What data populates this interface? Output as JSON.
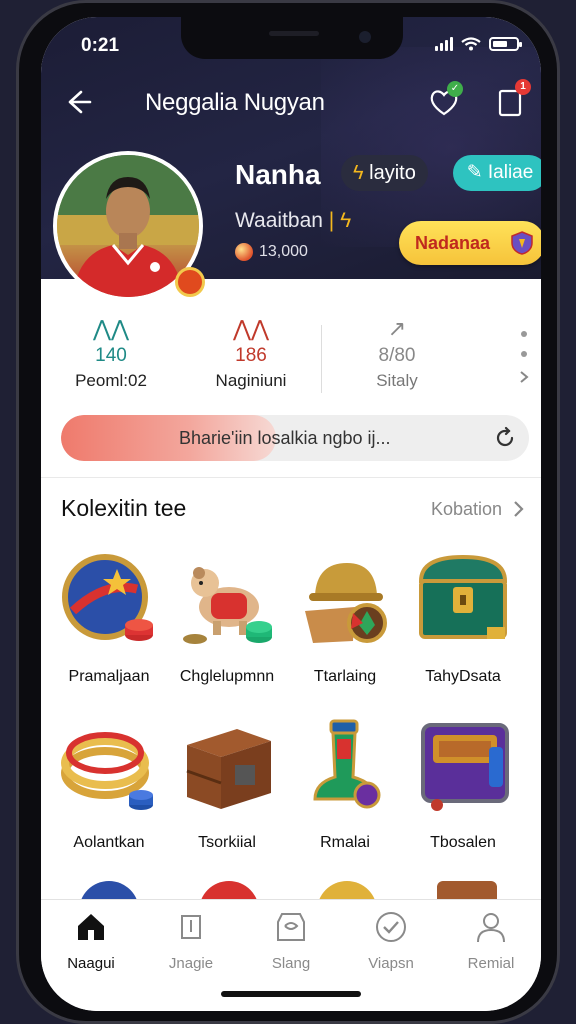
{
  "status_bar": {
    "time": "0:21"
  },
  "header": {
    "title": "Neggalia Nugyan",
    "notification_badge": "1"
  },
  "profile": {
    "name": "Nanha",
    "pill_label": "layito",
    "cyan_label": "Ialiae",
    "subtitle": "Waaitban",
    "coins": "13,000",
    "action_label": "Nadanaa"
  },
  "stats": [
    {
      "value": "140",
      "label": "Peoml:02",
      "color": "#1f8a86"
    },
    {
      "value": "186",
      "label": "Naginiuni",
      "color": "#c0392b"
    },
    {
      "value": "8/80",
      "label": "Sitaly",
      "color": "#888888"
    }
  ],
  "progress": {
    "text": "Bharie'iin losalkia ngbo ij...",
    "percent": 46
  },
  "collection": {
    "title": "Kolexitin tee",
    "link": "Kobation",
    "items": [
      {
        "name": "Pramaljaan",
        "icon": "shield-ball-icon"
      },
      {
        "name": "Chglelupmnn",
        "icon": "dog-toy-icon"
      },
      {
        "name": "Ttarlaing",
        "icon": "helmet-icon"
      },
      {
        "name": "TahyDsata",
        "icon": "treasure-chest-icon"
      },
      {
        "name": "Aolantkan",
        "icon": "coil-icon"
      },
      {
        "name": "Tsorkiial",
        "icon": "wooden-crate-icon"
      },
      {
        "name": "Rmalai",
        "icon": "trophy-boot-icon"
      },
      {
        "name": "Tbosalen",
        "icon": "purple-chest-icon"
      }
    ]
  },
  "tabs": [
    {
      "label": "Naagui",
      "active": true
    },
    {
      "label": "Jnagie",
      "active": false
    },
    {
      "label": "Slang",
      "active": false
    },
    {
      "label": "Viapsn",
      "active": false
    },
    {
      "label": "Remial",
      "active": false
    }
  ]
}
